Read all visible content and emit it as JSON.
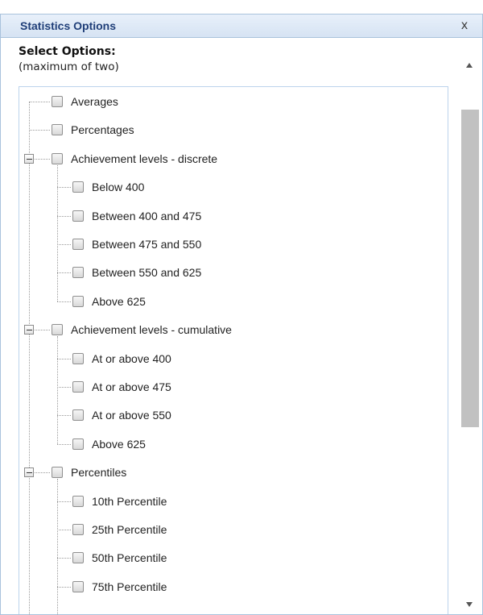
{
  "dialog": {
    "title": "Statistics Options",
    "close_label": "x",
    "select_heading": "Select Options:",
    "select_subheading": "(maximum of two)"
  },
  "tree": {
    "items": [
      {
        "label": "Averages",
        "level": 0,
        "checked": false,
        "expander": false
      },
      {
        "label": "Percentages",
        "level": 0,
        "checked": false,
        "expander": false
      },
      {
        "label": "Achievement levels - discrete",
        "level": 0,
        "checked": false,
        "expander": true,
        "expanded": true
      },
      {
        "label": "Below 400",
        "level": 1,
        "checked": false,
        "expander": false
      },
      {
        "label": "Between 400 and 475",
        "level": 1,
        "checked": false,
        "expander": false
      },
      {
        "label": "Between 475 and 550",
        "level": 1,
        "checked": false,
        "expander": false
      },
      {
        "label": "Between 550 and 625",
        "level": 1,
        "checked": false,
        "expander": false
      },
      {
        "label": "Above 625",
        "level": 1,
        "checked": false,
        "expander": false
      },
      {
        "label": "Achievement levels - cumulative",
        "level": 0,
        "checked": false,
        "expander": true,
        "expanded": true
      },
      {
        "label": "At or above 400",
        "level": 1,
        "checked": false,
        "expander": false
      },
      {
        "label": "At or above 475",
        "level": 1,
        "checked": false,
        "expander": false
      },
      {
        "label": "At or above 550",
        "level": 1,
        "checked": false,
        "expander": false
      },
      {
        "label": "Above 625",
        "level": 1,
        "checked": false,
        "expander": false
      },
      {
        "label": "Percentiles",
        "level": 0,
        "checked": false,
        "expander": true,
        "expanded": true
      },
      {
        "label": "10th Percentile",
        "level": 1,
        "checked": false,
        "expander": false
      },
      {
        "label": "25th Percentile",
        "level": 1,
        "checked": false,
        "expander": false
      },
      {
        "label": "50th Percentile",
        "level": 1,
        "checked": false,
        "expander": false
      },
      {
        "label": "75th Percentile",
        "level": 1,
        "checked": false,
        "expander": false
      }
    ]
  },
  "icons": {
    "close": "close-icon",
    "collapse": "minus-toggle-icon",
    "scroll_up": "chevron-up-icon",
    "scroll_down": "chevron-down-icon"
  },
  "colors": {
    "title_text": "#1f3e78",
    "titlebar_bg": "#dbe6f4",
    "border": "#a9c2dc",
    "scroll_thumb": "#c1c1c1"
  }
}
